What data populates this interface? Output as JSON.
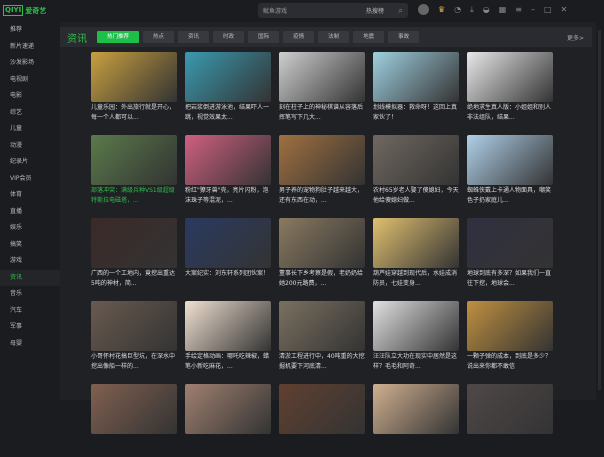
{
  "app": {
    "logo_box": "QIYI",
    "logo_text": "爱奇艺"
  },
  "search": {
    "placeholder": "鱿鱼游戏",
    "hot_label": "热搜榜"
  },
  "toolbar_icons": [
    "avatar",
    "vip-crown-icon",
    "history-icon",
    "download-icon",
    "game-icon",
    "apps-icon",
    "menu-icon",
    "minimize-icon",
    "maximize-icon",
    "close-icon"
  ],
  "sidebar": {
    "items": [
      "推荐",
      "新片速递",
      "沙发影场",
      "电视剧",
      "电影",
      "综艺",
      "儿童",
      "动漫",
      "纪录片",
      "VIP会员",
      "体育",
      "直播",
      "娱乐",
      "搞笑",
      "游戏",
      "资讯",
      "音乐",
      "汽车",
      "军事",
      "母婴"
    ],
    "active": "资讯"
  },
  "section": {
    "title": "资讯",
    "tabs": [
      "热门推荐",
      "热点",
      "资讯",
      "时政",
      "国际",
      "疫情",
      "法制",
      "地震",
      "事故"
    ],
    "active_tab": "热门推荐",
    "more": "更多>"
  },
  "accent": "#1dbf49",
  "cards": [
    {
      "title": "儿童乐园：外出旅行就是开心，每一个人都可以...",
      "color": "#c8a040"
    },
    {
      "title": "把岩浆倒进游泳池，结果吓人一跳，视觉效果太...",
      "color": "#3a9ab0"
    },
    {
      "title": "刻在柱子上的神秘棋谱从容落后挥笔写下几大...",
      "color": "#cfcfcf"
    },
    {
      "title": "划线模拟器：救命呀！这回上真家伙了！",
      "color": "#9fd0e0"
    },
    {
      "title": "绝地求生真人版：小姐姐和别人非法组队，结果...",
      "color": "#e8e8e8"
    },
    {
      "title": "部落冲突：满级兵种VS1级超级特斯拉电磁塔，...",
      "color": "#5a7a4a",
      "green": true
    },
    {
      "title": "粉红\"獠牙兽\"壳，亮片闪粉，泡沫珠子等混泥，...",
      "color": "#d06080"
    },
    {
      "title": "男子养的宠物狗肚子越来越大，还有东西在动，...",
      "color": "#a07040"
    },
    {
      "title": "农村65岁老人娶了傻媳妇，今天他给傻媳妇做...",
      "color": "#706860"
    },
    {
      "title": "蜘蛛侠戴上卡通人物面具，嘲笑色子扔家庭儿...",
      "color": "#b0d0e8"
    },
    {
      "title": "广西的一个工地内，竟挖出重达5吨的神材，简...",
      "color": "#3a2a28"
    },
    {
      "title": "大案纪实：刘东轩系列团伙案！",
      "color": "#2a3a60"
    },
    {
      "title": "董事长下乡考察是假，老奶奶给她200元路费，...",
      "color": "#8a7a60"
    },
    {
      "title": "葫芦娃穿越到现代后，水娃成消防员，七娃变身...",
      "color": "#e0c070"
    },
    {
      "title": "地球到底有多深？如果我们一直往下挖，地球会...",
      "color": "#303040"
    },
    {
      "title": "小哥怀村花搞巨型坑，在深水中挖出像船一样的...",
      "color": "#6a5a50"
    },
    {
      "title": "手绘定格动画：哪吒吃辣椒，蜡笔小新吃麻花，...",
      "color": "#f0e0d0"
    },
    {
      "title": "清淤工程进行中，40吨重的大挖掘机要下河底清...",
      "color": "#7a7060"
    },
    {
      "title": "汪汪队立大功在现实中居然是这样？毛毛和阿奇...",
      "color": "#e0e0e0"
    },
    {
      "title": "一颗子弹的成本，到底是多少？说出来你都不敢信",
      "color": "#c09040"
    },
    {
      "title": "",
      "color": "#806050"
    },
    {
      "title": "",
      "color": "#a08070"
    },
    {
      "title": "",
      "color": "#604030"
    },
    {
      "title": "",
      "color": "#d0b090"
    },
    {
      "title": "",
      "color": "#504848"
    }
  ]
}
